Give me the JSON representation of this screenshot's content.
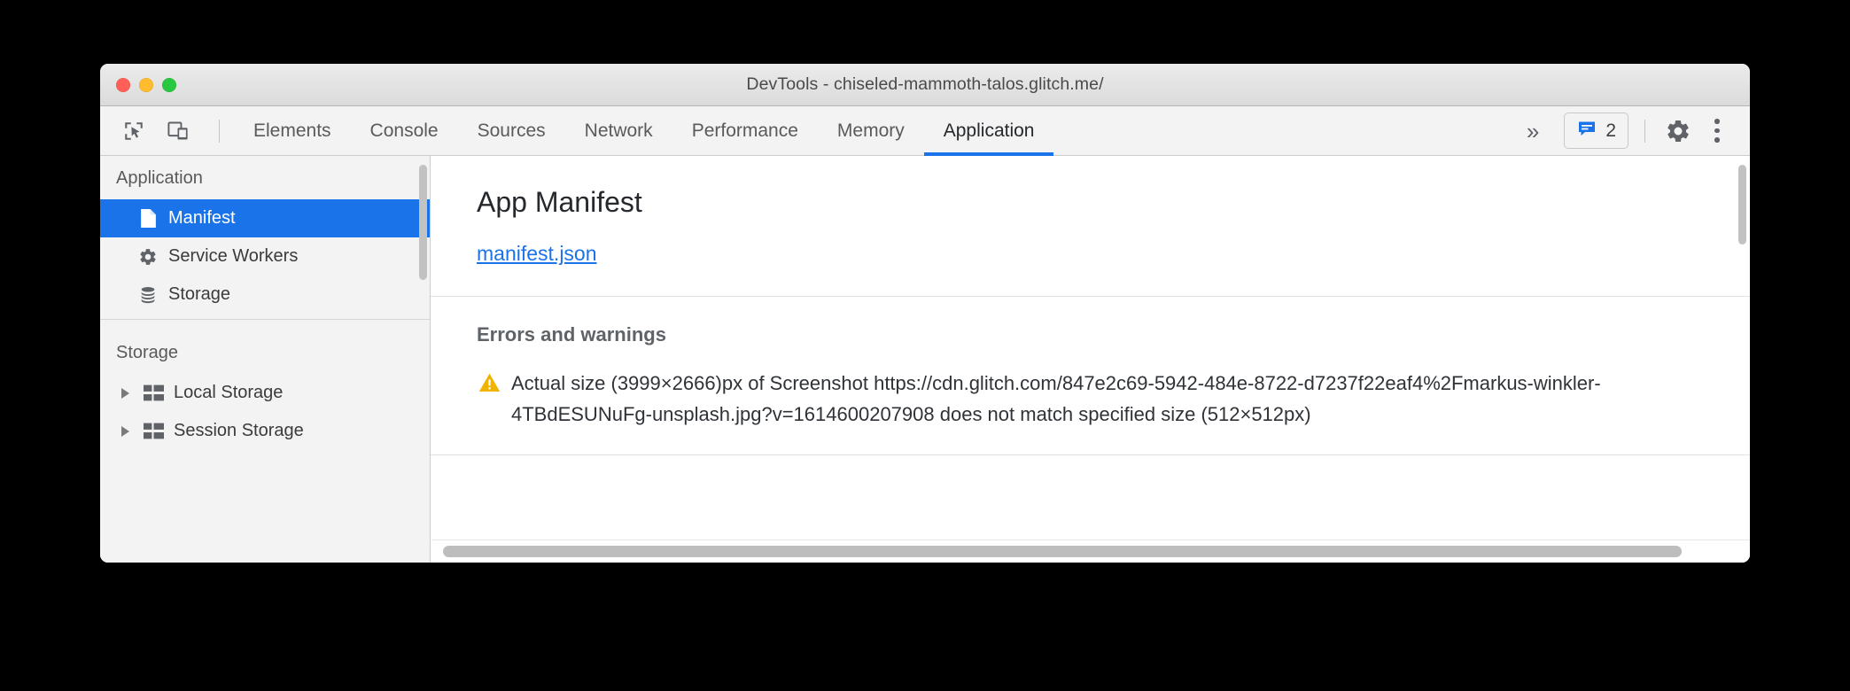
{
  "window": {
    "title": "DevTools - chiseled-mammoth-talos.glitch.me/",
    "traffic_lights": [
      "close-red",
      "minimize-yellow",
      "maximize-green"
    ]
  },
  "tabbar": {
    "left_icons": [
      {
        "name": "inspect-element-icon",
        "label": "Inspect element"
      },
      {
        "name": "device-toolbar-icon",
        "label": "Toggle device toolbar"
      }
    ],
    "tabs": [
      {
        "label": "Elements",
        "active": false
      },
      {
        "label": "Console",
        "active": false
      },
      {
        "label": "Sources",
        "active": false
      },
      {
        "label": "Network",
        "active": false
      },
      {
        "label": "Performance",
        "active": false
      },
      {
        "label": "Memory",
        "active": false
      },
      {
        "label": "Application",
        "active": true
      }
    ],
    "more_tabs_label": "»",
    "message_badge": {
      "icon": "message-icon",
      "count": "2",
      "color": "#1a73e8"
    },
    "settings_icon": "gear-icon",
    "menu_icon": "kebab-menu-icon"
  },
  "sidebar": {
    "sections": [
      {
        "title": "Application",
        "items": [
          {
            "label": "Manifest",
            "icon": "document-icon",
            "selected": true,
            "expandable": false
          },
          {
            "label": "Service Workers",
            "icon": "gear-icon",
            "selected": false,
            "expandable": false
          },
          {
            "label": "Storage",
            "icon": "database-icon",
            "selected": false,
            "expandable": false
          }
        ]
      },
      {
        "title": "Storage",
        "items": [
          {
            "label": "Local Storage",
            "icon": "table-icon",
            "selected": false,
            "expandable": true
          },
          {
            "label": "Session Storage",
            "icon": "table-icon",
            "selected": false,
            "expandable": true
          }
        ]
      }
    ]
  },
  "main": {
    "title": "App Manifest",
    "manifest_link": "manifest.json",
    "errors_section_title": "Errors and warnings",
    "warnings": [
      {
        "icon": "warning-triangle-icon",
        "icon_color": "#f0b400",
        "text": "Actual size (3999×2666)px of Screenshot https://cdn.glitch.com/847e2c69-5942-484e-8722-d7237f22eaf4%2Fmarkus-winkler-4TBdESUNuFg-unsplash.jpg?v=1614600207908 does not match specified size (512×512px)"
      }
    ]
  },
  "colors": {
    "accent": "#1a73e8",
    "selection": "#1a73e8",
    "warning": "#f0b400",
    "chrome_bg": "#f3f3f3"
  }
}
